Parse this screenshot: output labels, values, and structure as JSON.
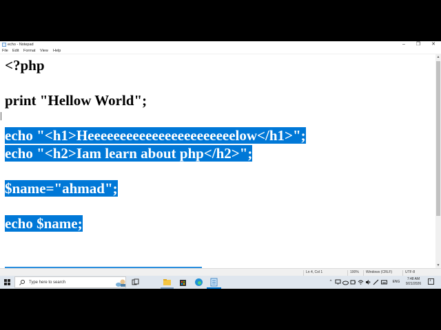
{
  "window": {
    "title": "echo - Notepad",
    "controls": {
      "minimize": "–",
      "maximize": "❐",
      "close": "✕"
    }
  },
  "menu": [
    "File",
    "Edit",
    "Format",
    "View",
    "Help"
  ],
  "editor": {
    "lines": [
      {
        "text": "<?php",
        "selected": false
      },
      {
        "text": "print \"Hellow World\";",
        "selected": false
      },
      {
        "text": "echo \"<h1>Heeeeeeeeeeeeeeeeeeeeeeelow</h1>\";",
        "selected": true
      },
      {
        "text": "echo \"<h2>Iam learn about php</h2>\";",
        "selected": true
      },
      {
        "text": "$name=\"ahmad\";",
        "selected": true
      },
      {
        "text": "echo $name;",
        "selected": true
      }
    ]
  },
  "status_bar": {
    "position": "Ln 4, Col 1",
    "zoom": "100%",
    "line_endings": "Windows (CRLF)",
    "encoding": "UTF-8"
  },
  "taskbar": {
    "search_placeholder": "Type here to search",
    "pinned": [
      "task-view",
      "file-explorer",
      "microsoft-store",
      "edge",
      "notepad"
    ],
    "tray": {
      "chevron": "^",
      "language": "ENG",
      "time": "7:48 AM",
      "date": "9/21/2026"
    }
  },
  "colors": {
    "selection": "#0078d7",
    "selection_text": "#ffffff",
    "taskbar": "#dfe6ee"
  }
}
